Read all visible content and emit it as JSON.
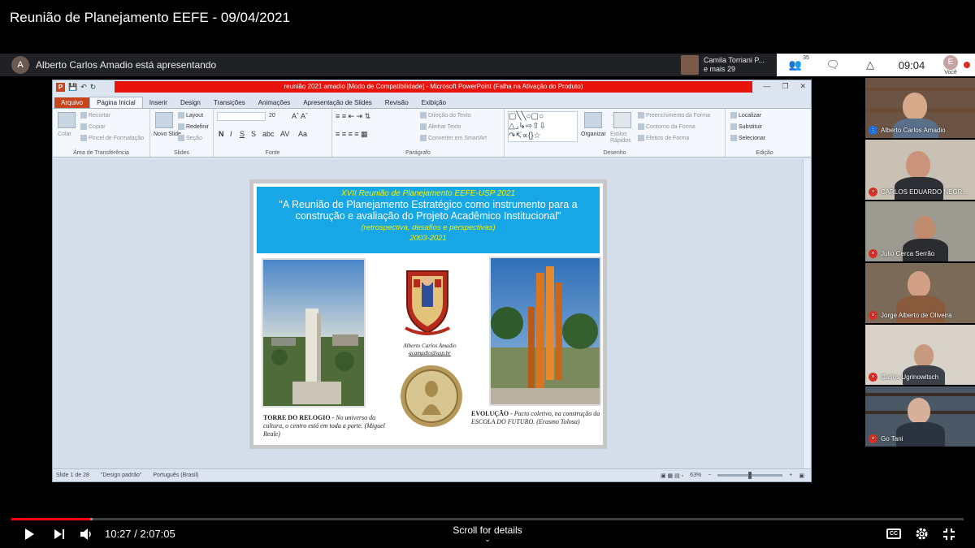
{
  "video": {
    "title": "Reunião de Planejamento EEFE - 09/04/2021",
    "current_time": "10:27",
    "duration": "2:07:05",
    "time_display": "10:27 / 2:07:05",
    "progress_fraction": 0.083,
    "scroll_hint": "Scroll for details"
  },
  "meet": {
    "presenter_initial": "A",
    "presenting_text": "Alberto Carlos Amadio está apresentando",
    "featured_name": "Camila Torriani P...",
    "featured_sub": "e mais 29",
    "participants_count": "35",
    "clock": "09:04",
    "you_initial": "E",
    "you_label": "Você"
  },
  "ppt": {
    "window_title": "reunião 2021 amadio [Modo de Compatibilidade] - Microsoft PowerPoint (Falha na Ativação do Produto)",
    "app_badge": "P",
    "tabs": [
      "Arquivo",
      "Página Inicial",
      "Inserir",
      "Design",
      "Transições",
      "Animações",
      "Apresentação de Slides",
      "Revisão",
      "Exibição"
    ],
    "groups": {
      "clipboard": "Área de Transferência",
      "slides": "Slides",
      "font": "Fonte",
      "paragraph": "Parágrafo",
      "drawing": "Desenho",
      "editing": "Edição"
    },
    "ribbon": {
      "paste": "Colar",
      "cut": "Recortar",
      "copy": "Copiar",
      "format_painter": "Pincel de Formatação",
      "new_slide": "Novo Slide",
      "layout": "Layout",
      "reset": "Redefinir",
      "section": "Seção",
      "font_size": "20",
      "text_direction": "Direção do Texto",
      "align_text": "Alinhar Texto",
      "smartart": "Converter em SmartArt",
      "arrange": "Organizar",
      "quick_styles": "Estilos Rápidos",
      "shape_fill": "Preenchimento da Forma",
      "shape_outline": "Contorno da Forma",
      "shape_effects": "Efeitos de Forma",
      "find": "Localizar",
      "replace": "Substituir",
      "select": "Selecionar"
    },
    "status": {
      "slide": "Slide 1 de 28",
      "theme": "\"Design padrão\"",
      "language": "Português (Brasil)",
      "zoom": "63%"
    }
  },
  "slide": {
    "line1": "XVII Reunião de Planejamento EEFE-USP 2021",
    "line2": "\"A Reunião de Planejamento Estratégico como instrumento para a construção e avaliação do Projeto Acadêmico Institucional\"",
    "line3": "(retrospectiva, desafios e perspectivas)",
    "line4": "2003-2021",
    "author": "Alberto Carlos Amadio",
    "email": "acamadio@usp.br",
    "left_caption_bold": "TORRE DO RELOGIO -",
    "left_caption": "No universo da cultura, o centro está em toda a parte. (Miguel Reale)",
    "right_caption_bold": "EVOLUÇÃO -",
    "right_caption": "Pacto coletivo, na construção da ESCOLA DO FUTURO. (Erasmo Tolosa)"
  },
  "participants": [
    {
      "name": "Alberto Carlos Amadio",
      "mic": "on"
    },
    {
      "name": "CARLOS EDUARDO NEGR...",
      "mic": "off"
    },
    {
      "name": "Julio Cerca Serrão",
      "mic": "off"
    },
    {
      "name": "Jorge Alberto de Oliveira",
      "mic": "off"
    },
    {
      "name": "Carlos Ugrinowitsch",
      "mic": "off"
    },
    {
      "name": "Go Tani",
      "mic": "off"
    }
  ],
  "colors": {
    "accent_red": "#d93025",
    "progress_red": "#ff0000",
    "ppt_file_tab": "#c6451c",
    "slide_header_blue": "#17a6e6",
    "slide_header_yellow": "#f6f000"
  }
}
